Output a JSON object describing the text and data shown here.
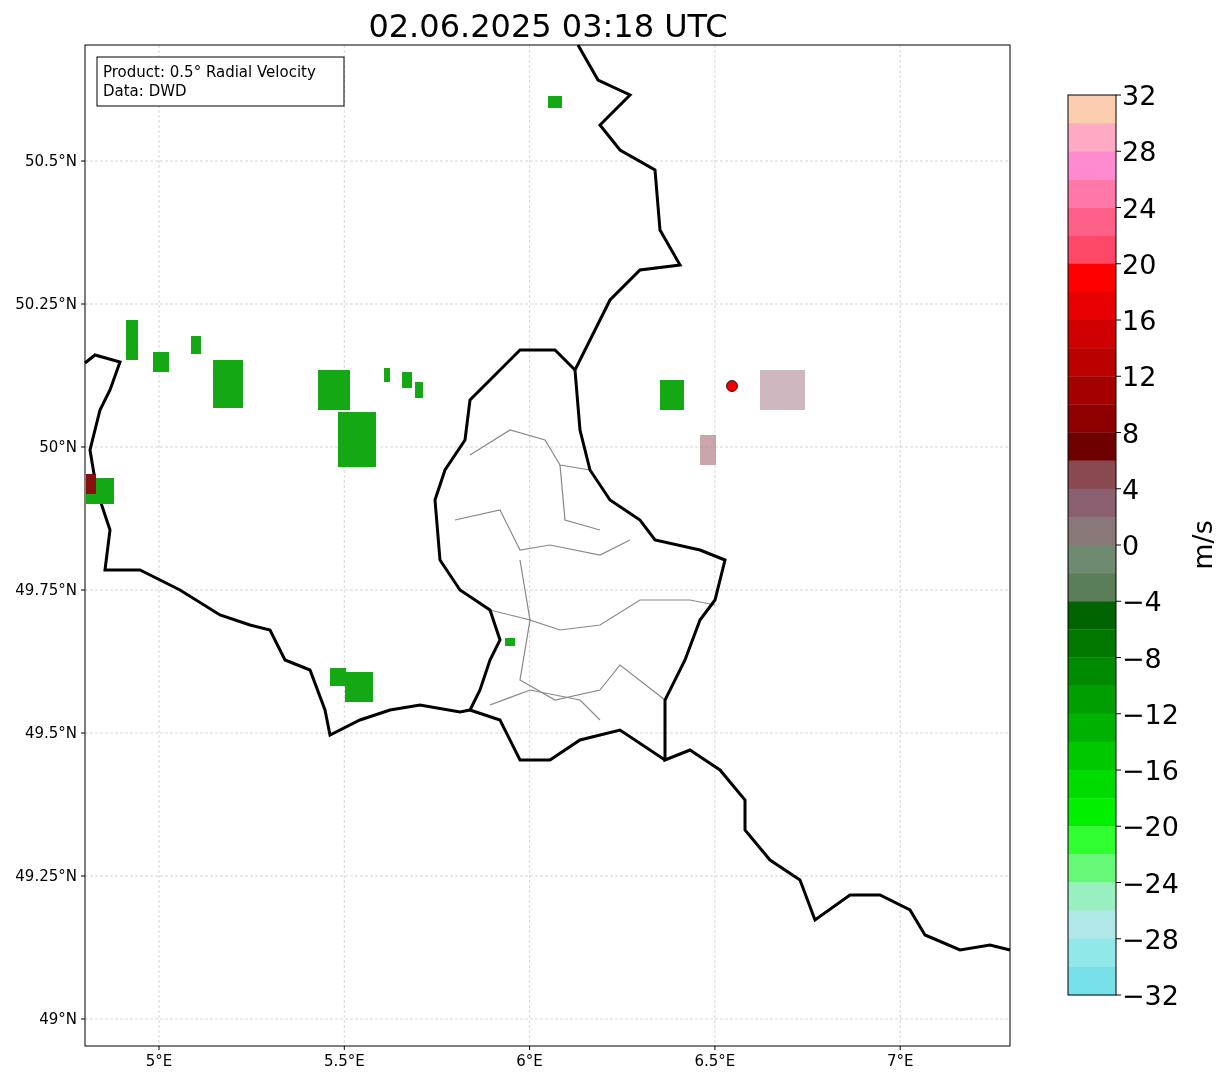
{
  "title": "02.06.2025 03:18 UTC",
  "legend": [
    "Product: 0.5° Radial Velocity",
    "Data: DWD"
  ],
  "map": {
    "yticks": [
      "50.5°N",
      "50.25°N",
      "50°N",
      "49.75°N",
      "49.5°N",
      "49.25°N",
      "49°N"
    ],
    "xticks": [
      "5°E",
      "5.5°E",
      "6°E",
      "6.5°E",
      "7°E"
    ]
  },
  "colorbar": {
    "label": "m/s",
    "ticks": [
      "32",
      "28",
      "24",
      "20",
      "16",
      "12",
      "8",
      "4",
      "0",
      "−4",
      "−8",
      "−12",
      "−16",
      "−20",
      "−24",
      "−28",
      "−32"
    ],
    "bands": [
      {
        "color": "#fdcdaf"
      },
      {
        "color": "#ffaac4"
      },
      {
        "color": "#ff8ad0"
      },
      {
        "color": "#ff78a8"
      },
      {
        "color": "#ff6088"
      },
      {
        "color": "#ff4868"
      },
      {
        "color": "#ff0000"
      },
      {
        "color": "#e80000"
      },
      {
        "color": "#d00000"
      },
      {
        "color": "#bb0000"
      },
      {
        "color": "#a50000"
      },
      {
        "color": "#8e0000"
      },
      {
        "color": "#6e0000"
      },
      {
        "color": "#8a4850"
      },
      {
        "color": "#8a6070"
      },
      {
        "color": "#8a7878"
      },
      {
        "color": "#6e8a70"
      },
      {
        "color": "#5a7e58"
      },
      {
        "color": "#006400"
      },
      {
        "color": "#007800"
      },
      {
        "color": "#008a00"
      },
      {
        "color": "#009e00"
      },
      {
        "color": "#00b200"
      },
      {
        "color": "#00c800"
      },
      {
        "color": "#00dc00"
      },
      {
        "color": "#00f000"
      },
      {
        "color": "#30ff30"
      },
      {
        "color": "#68f878"
      },
      {
        "color": "#98f0c0"
      },
      {
        "color": "#b0e8e8"
      },
      {
        "color": "#90e8e8"
      },
      {
        "color": "#78e0e8"
      }
    ]
  }
}
